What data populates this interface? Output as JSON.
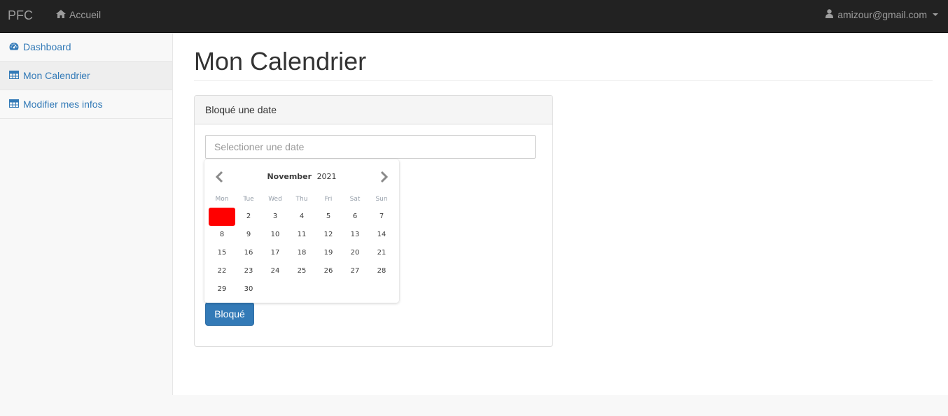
{
  "navbar": {
    "brand": "PFC",
    "home_label": "Accueil",
    "user_email": "amizour@gmail.com"
  },
  "sidebar": {
    "items": [
      {
        "label": "Dashboard",
        "icon": "dashboard-icon"
      },
      {
        "label": "Mon Calendrier",
        "icon": "table-icon",
        "active": true
      },
      {
        "label": "Modifier mes infos",
        "icon": "table-icon"
      }
    ]
  },
  "main": {
    "title": "Mon Calendrier",
    "panel": {
      "heading": "Bloqué une date",
      "date_placeholder": "Selectioner une date",
      "date_value": "",
      "submit_label": "Bloqué"
    }
  },
  "datepicker": {
    "month": "November",
    "year": "2021",
    "weekdays": [
      "Mon",
      "Tue",
      "Wed",
      "Thu",
      "Fri",
      "Sat",
      "Sun"
    ],
    "first_weekday_offset": 0,
    "days_in_month": 30,
    "selected_day": 1,
    "selected_color": "#ff0000"
  },
  "colors": {
    "navbar_bg": "#222222",
    "link": "#337ab7",
    "button_primary": "#337ab7"
  }
}
